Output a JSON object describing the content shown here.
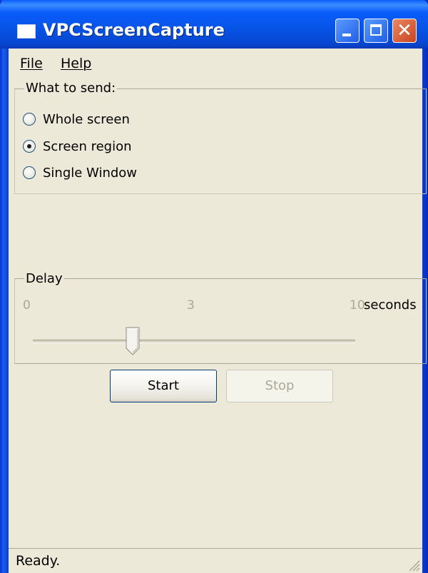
{
  "window": {
    "title": "VPCScreenCapture"
  },
  "menu": {
    "items": [
      {
        "label": "File"
      },
      {
        "label": "Help"
      }
    ]
  },
  "what_to_send": {
    "label": "What to send:",
    "options": [
      {
        "label": "Whole screen",
        "checked": false
      },
      {
        "label": "Screen region",
        "checked": true
      },
      {
        "label": "Single Window",
        "checked": false
      }
    ]
  },
  "delay": {
    "label": "Delay",
    "min_label": "0",
    "mid_label": "3",
    "max_label": "10",
    "unit": "seconds",
    "min": 0,
    "max": 10,
    "value": 3
  },
  "buttons": {
    "start": {
      "label": "Start",
      "enabled": true
    },
    "stop": {
      "label": "Stop",
      "enabled": false
    }
  },
  "status": {
    "text": "Ready."
  },
  "colors": {
    "titlebar": "#0a5dfb",
    "face": "#ece9d8",
    "disabled_text": "#aca899"
  }
}
